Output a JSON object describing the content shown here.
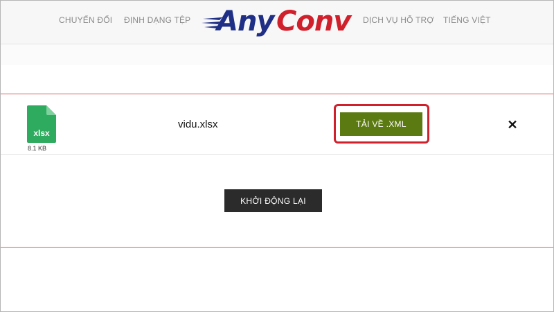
{
  "header": {
    "nav": [
      "CHUYỂN ĐỔI",
      "ĐỊNH DẠNG TỆP",
      "DỊCH VỤ HỖ TRỢ",
      "TIẾNG VIỆT"
    ],
    "logo": {
      "part1": "Any",
      "part2": "Conv",
      "brand_blue": "#1f2f86",
      "brand_red": "#d0202c"
    }
  },
  "file": {
    "icon": "xlsx-file-icon",
    "ext_label": "xlsx",
    "size": "8.1 KB",
    "name": "vidu.xlsx",
    "icon_color": "#2eab5e"
  },
  "actions": {
    "download_label": "TẢI VỀ .XML",
    "download_color": "#5c7a12",
    "highlight_color": "#d0202c",
    "close_icon": "close-icon",
    "restart_label": "KHỞI ĐỘNG LẠI"
  }
}
